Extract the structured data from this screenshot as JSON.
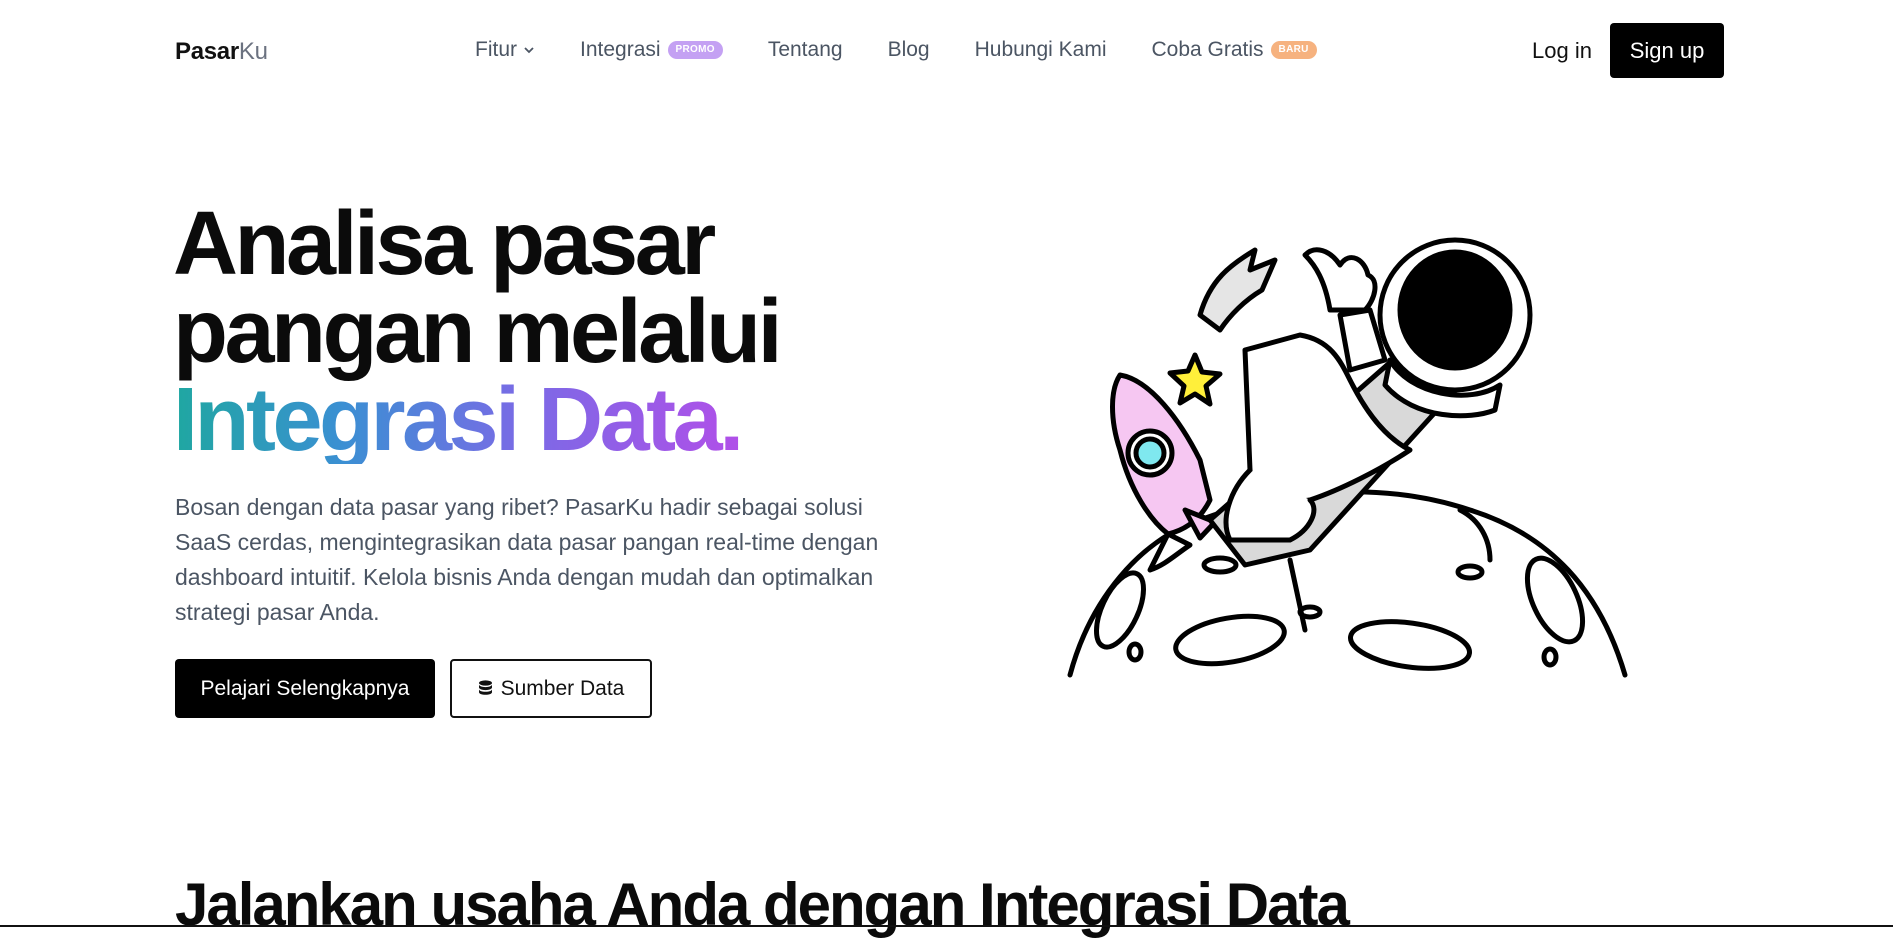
{
  "brand": {
    "part1": "Pasar",
    "part2": "Ku"
  },
  "nav": {
    "items": [
      {
        "label": "Fitur",
        "has_dropdown": true
      },
      {
        "label": "Integrasi",
        "badge": "PROMO",
        "badge_color": "#c4a1f3"
      },
      {
        "label": "Tentang"
      },
      {
        "label": "Blog"
      },
      {
        "label": "Hubungi Kami"
      },
      {
        "label": "Coba Gratis",
        "badge": "BARU",
        "badge_color": "#f6b27f"
      }
    ],
    "login": "Log in",
    "signup": "Sign up"
  },
  "hero": {
    "title_line1": "Analisa pasar",
    "title_line2": "pangan melalui",
    "title_highlight": "Integrasi Data.",
    "description": "Bosan dengan data pasar yang ribet? PasarKu hadir sebagai solusi SaaS cerdas, mengintegrasikan data pasar pangan real-time dengan dashboard intuitif. Kelola bisnis Anda dengan mudah dan optimalkan strategi pasar Anda.",
    "primary_button": "Pelajari Selengkapnya",
    "secondary_button": "Sumber Data",
    "secondary_icon": "database-icon",
    "illustration": "astronaut-moon-illustration"
  },
  "section": {
    "title": "Jalankan usaha Anda dengan Integrasi Data"
  },
  "colors": {
    "gradient": [
      "#1fa7a1",
      "#3b8fd3",
      "#7b6ae6",
      "#b14fe8"
    ],
    "primary": "#000000",
    "text_muted": "#4b5563"
  }
}
